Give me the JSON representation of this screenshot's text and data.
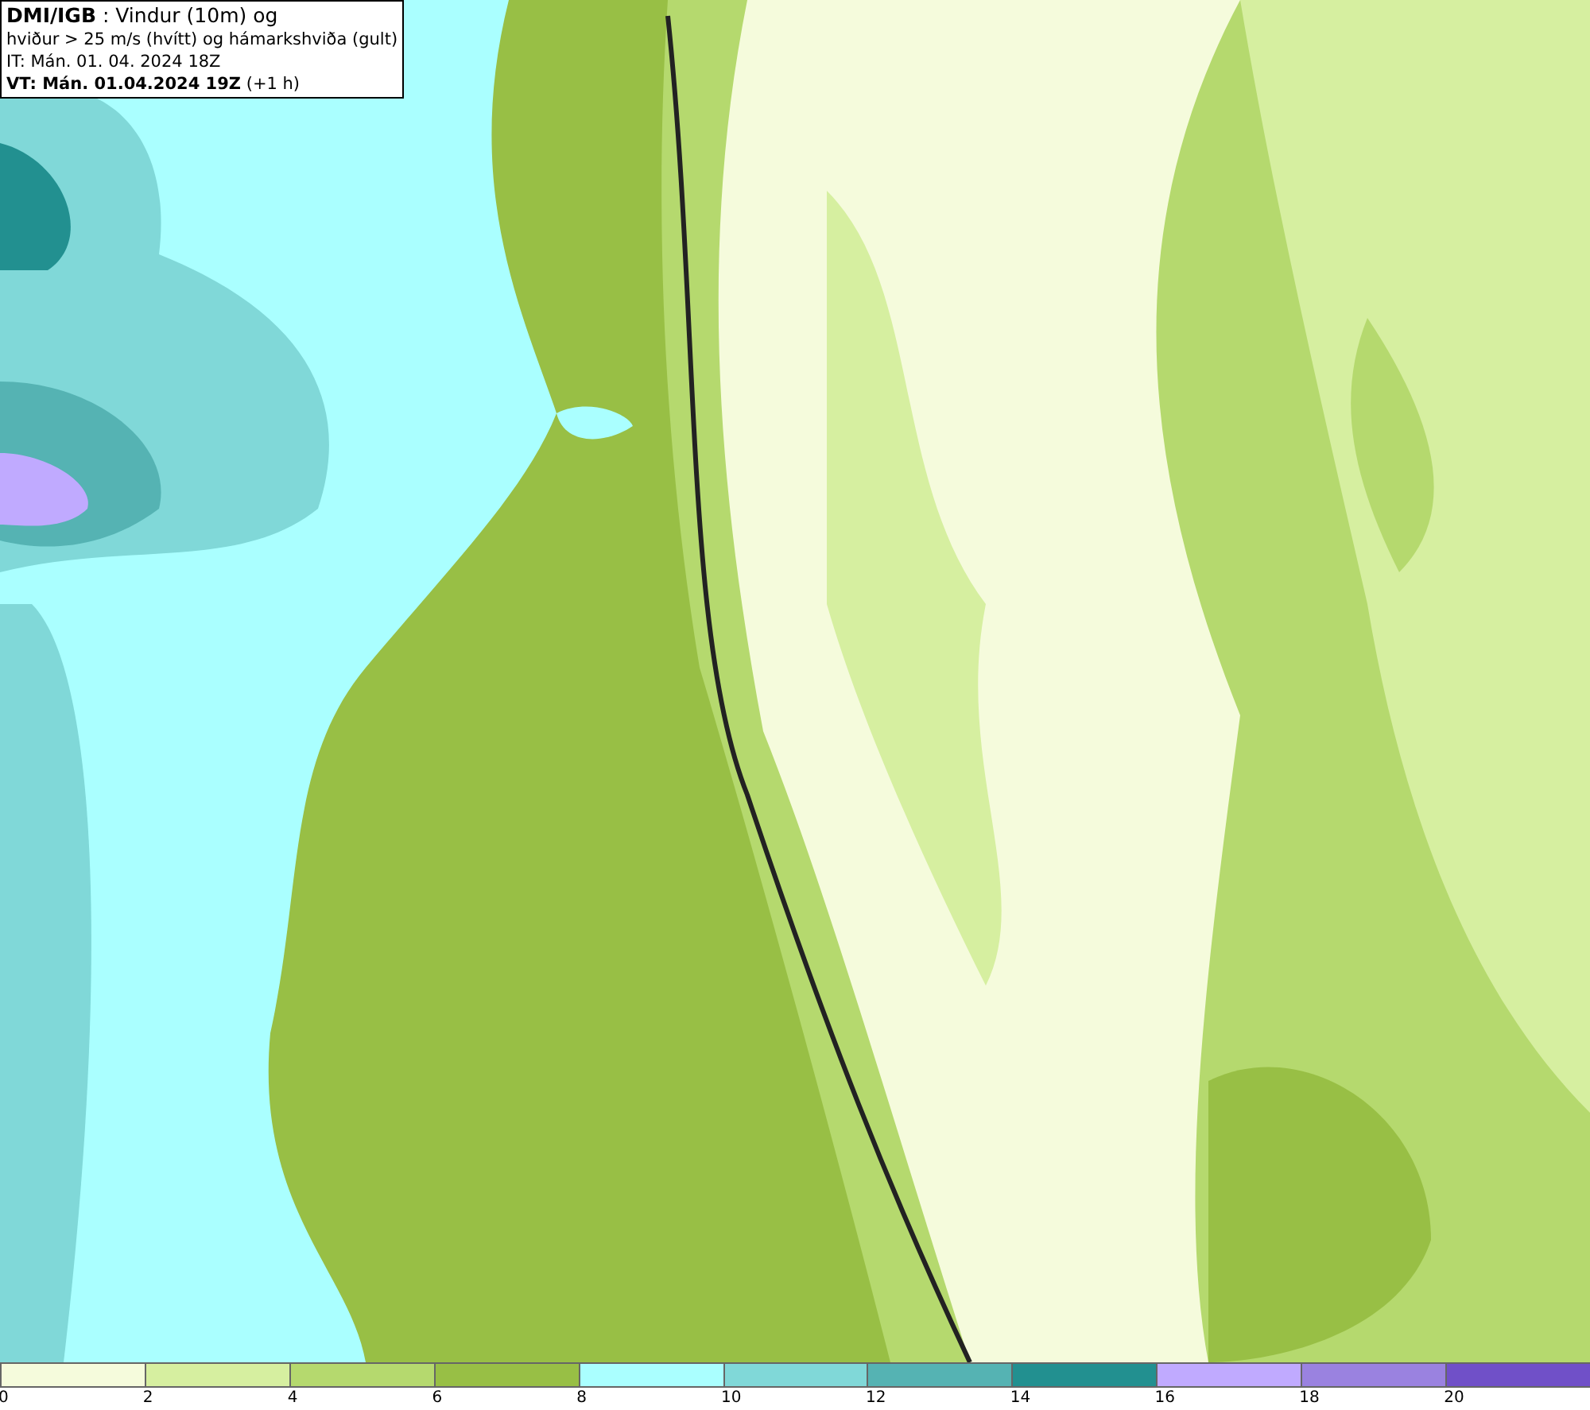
{
  "header": {
    "lines": [
      "**DMI/IGB** : Vindur (10m) og",
      "hviður > 25 m/s (hvítt) og hámarkshviða (gult)",
      "IT: Mán. 01. 04. 2024 18Z",
      "**VT: Mán. 01.04.2024 19Z** (+1 h)"
    ]
  },
  "legend": {
    "bins": [
      {
        "color": "#f5fbdc"
      },
      {
        "color": "#d6efa0"
      },
      {
        "color": "#b5d96e"
      },
      {
        "color": "#98bf45"
      },
      {
        "color": "#aaffff"
      },
      {
        "color": "#80d8d8"
      },
      {
        "color": "#55b3b3"
      },
      {
        "color": "#229090"
      },
      {
        "color": "#c0aaff"
      },
      {
        "color": "#9a82e0"
      },
      {
        "color": "#7050c8"
      }
    ],
    "ticks": [
      "0",
      "2",
      "4",
      "6",
      "8",
      "10",
      "12",
      "14",
      "16",
      "18",
      "20"
    ]
  }
}
